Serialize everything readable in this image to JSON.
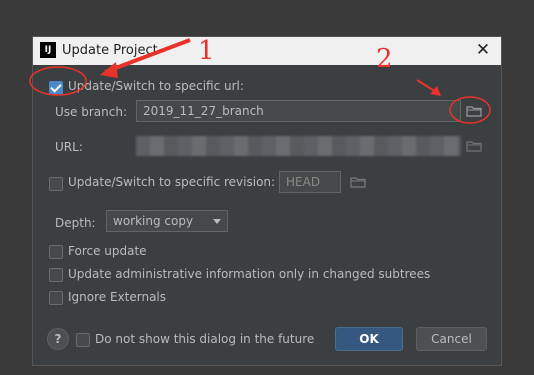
{
  "dialog": {
    "title": "Update Project",
    "app_icon_text": "IJ",
    "close_glyph": "✕"
  },
  "options": {
    "update_switch_url_label": "Update/Switch to specific url:",
    "update_switch_url_checked": true,
    "use_branch_label": "Use branch:",
    "use_branch_value": "2019_11_27_branch",
    "url_label": "URL:",
    "update_switch_revision_label": "Update/Switch to specific revision:",
    "update_switch_revision_checked": false,
    "revision_value": "HEAD",
    "depth_label": "Depth:",
    "depth_value": "working copy",
    "force_update_label": "Force update",
    "update_admin_label": "Update administrative information only in changed subtrees",
    "ignore_externals_label": "Ignore Externals"
  },
  "footer": {
    "help_glyph": "?",
    "dont_show_label": "Do not show this dialog in the future",
    "ok_label": "OK",
    "cancel_label": "Cancel"
  },
  "annotations": {
    "marker_1": "1",
    "marker_2": "2",
    "color": "#e8322a"
  },
  "colors": {
    "dialog_bg": "#3c3f41",
    "accent": "#4a88c7",
    "ok_button": "#365880"
  },
  "icons": [
    "app-icon",
    "close-icon",
    "folder-icon",
    "chevron-down-icon",
    "help-icon",
    "checkmark-icon"
  ]
}
